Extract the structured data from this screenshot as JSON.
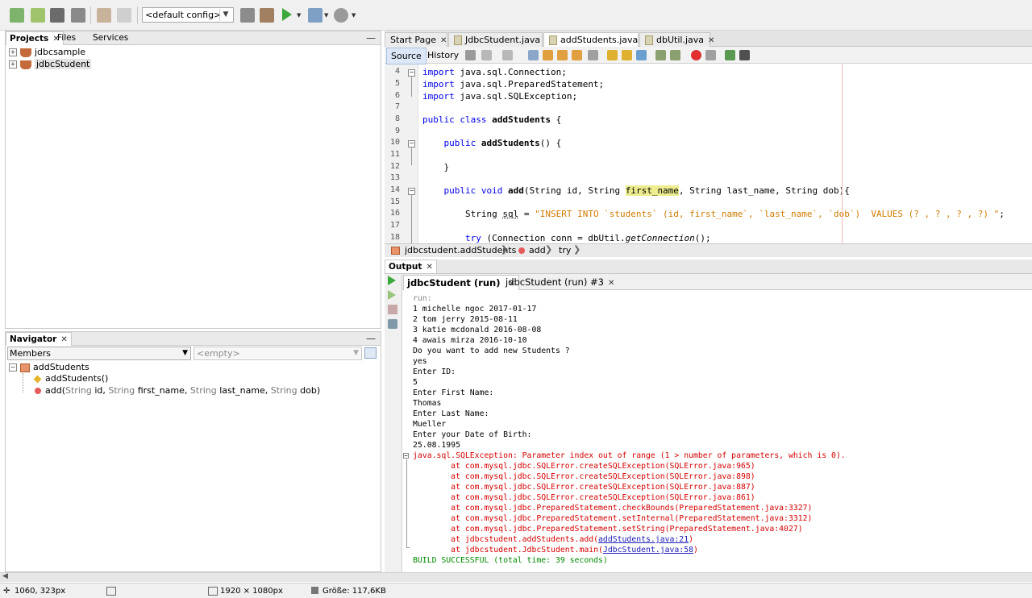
{
  "toolbar": {
    "config": "<default config>"
  },
  "projects_panel": {
    "tabs": [
      "Projects",
      "Files",
      "Services"
    ],
    "items": [
      "jdbcsample",
      "jdbcStudent"
    ]
  },
  "navigator_panel": {
    "title": "Navigator",
    "filter": "Members",
    "empty_placeholder": "<empty>",
    "root": "addStudents",
    "members": [
      {
        "name": "addStudents()"
      },
      {
        "name": "add",
        "params": [
          {
            "type": "String",
            "name": "id"
          },
          {
            "type": "String",
            "name": "first_name"
          },
          {
            "type": "String",
            "name": "last_name"
          },
          {
            "type": "String",
            "name": "dob"
          }
        ]
      }
    ]
  },
  "editor": {
    "tabs": [
      "Start Page",
      "JdbcStudent.java",
      "addStudents.java",
      "dbUtil.java"
    ],
    "active_tab": "addStudents.java",
    "source_label": "Source",
    "history_label": "History",
    "line_numbers": [
      "4",
      "5",
      "6",
      "7",
      "8",
      "9",
      "10",
      "11",
      "12",
      "13",
      "14",
      "15",
      "16",
      "17",
      "18"
    ],
    "lines": [
      "import java.sql.Connection;",
      "import java.sql.PreparedStatement;",
      "import java.sql.SQLException;",
      "",
      "public class addStudents {",
      "",
      "    public addStudents() {",
      "",
      "    }",
      "",
      "    public void add(String id, String first_name, String last_name, String dob){",
      "",
      "        String sql = \"INSERT INTO `students` (id, first_name`, `last_name`, `dob`)  VALUES (? , ? , ? , ?) \";",
      "",
      "        try (Connection conn = dbUtil.getConnection();"
    ],
    "breadcrumbs": [
      "jdbcstudent.addStudents",
      "add",
      "try"
    ]
  },
  "output": {
    "title": "Output",
    "tabs": [
      "jdbcStudent (run)",
      "jdbcStudent (run) #3"
    ],
    "lines": [
      {
        "text": "run:",
        "kind": "dim"
      },
      {
        "text": "1 michelle ngoc 2017-01-17",
        "kind": "normal"
      },
      {
        "text": "2 tom jerry 2015-08-11",
        "kind": "normal"
      },
      {
        "text": "3 katie mcdonald 2016-08-08",
        "kind": "normal"
      },
      {
        "text": "4 awais mirza 2016-10-10",
        "kind": "normal"
      },
      {
        "text": "Do you want to add new Students ?",
        "kind": "normal"
      },
      {
        "text": "yes",
        "kind": "normal"
      },
      {
        "text": "Enter ID:",
        "kind": "normal"
      },
      {
        "text": "5",
        "kind": "normal"
      },
      {
        "text": "Enter First Name:",
        "kind": "normal"
      },
      {
        "text": "Thomas",
        "kind": "normal"
      },
      {
        "text": "Enter Last Name:",
        "kind": "normal"
      },
      {
        "text": "Mueller",
        "kind": "normal"
      },
      {
        "text": "Enter your Date of Birth:",
        "kind": "normal"
      },
      {
        "text": "25.08.1995",
        "kind": "normal"
      },
      {
        "text": "java.sql.SQLException: Parameter index out of range (1 > number of parameters, which is 0).",
        "kind": "err"
      },
      {
        "text": "        at com.mysql.jdbc.SQLError.createSQLException(SQLError.java:965)",
        "kind": "err"
      },
      {
        "text": "        at com.mysql.jdbc.SQLError.createSQLException(SQLError.java:898)",
        "kind": "err"
      },
      {
        "text": "        at com.mysql.jdbc.SQLError.createSQLException(SQLError.java:887)",
        "kind": "err"
      },
      {
        "text": "        at com.mysql.jdbc.SQLError.createSQLException(SQLError.java:861)",
        "kind": "err"
      },
      {
        "text": "        at com.mysql.jdbc.PreparedStatement.checkBounds(PreparedStatement.java:3327)",
        "kind": "err"
      },
      {
        "text": "        at com.mysql.jdbc.PreparedStatement.setInternal(PreparedStatement.java:3312)",
        "kind": "err"
      },
      {
        "text": "        at com.mysql.jdbc.PreparedStatement.setString(PreparedStatement.java:4027)",
        "kind": "err"
      },
      {
        "text": "        at jdbcstudent.addStudents.add(",
        "link": "addStudents.java:21",
        "tail": ")",
        "kind": "err"
      },
      {
        "text": "        at jdbcstudent.JdbcStudent.main(",
        "link": "JdbcStudent.java:58",
        "tail": ")",
        "kind": "err"
      },
      {
        "text": "BUILD SUCCESSFUL (total time: 39 seconds)",
        "kind": "ok"
      }
    ]
  },
  "statusbar": {
    "position": "1060, 323px",
    "dimensions": "1920 × 1080px",
    "size": "Größe: 117,6KB"
  }
}
